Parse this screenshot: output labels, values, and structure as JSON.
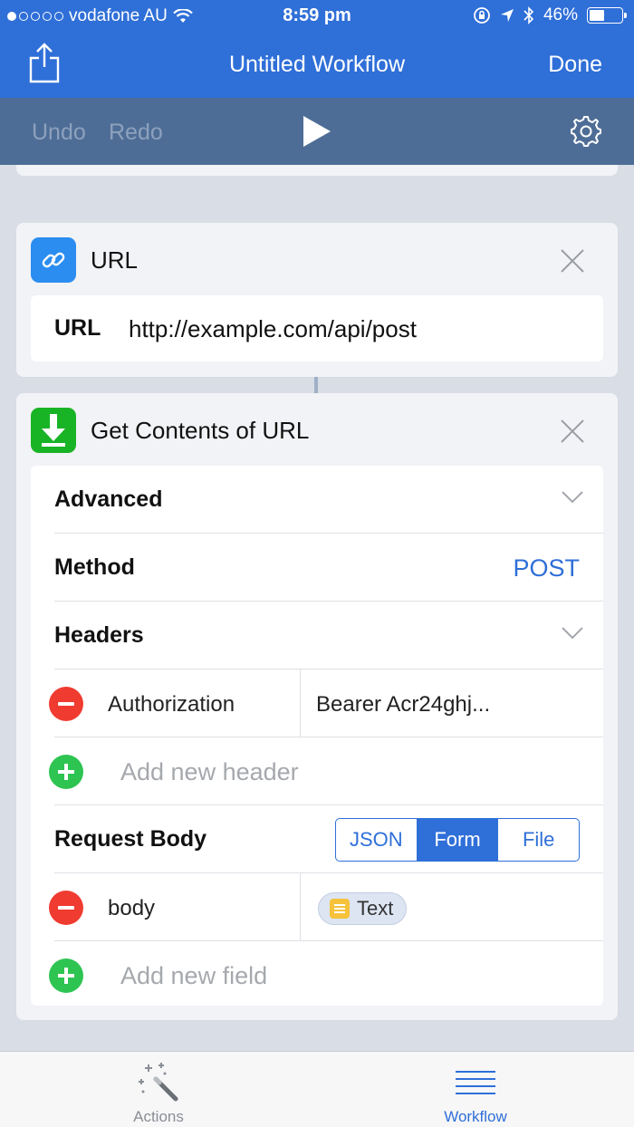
{
  "status": {
    "carrier": "vodafone AU",
    "time": "8:59 pm",
    "battery": "46%",
    "signal_bars": 1
  },
  "nav": {
    "title": "Untitled Workflow",
    "done_label": "Done"
  },
  "toolbar": {
    "undo_label": "Undo",
    "redo_label": "Redo"
  },
  "url_action": {
    "title": "URL",
    "field_label": "URL",
    "field_value": "http://example.com/api/post"
  },
  "get_action": {
    "title": "Get Contents of URL",
    "advanced_label": "Advanced",
    "method_label": "Method",
    "method_value": "POST",
    "headers_label": "Headers",
    "header_key": "Authorization",
    "header_value": "Bearer Acr24ghj...",
    "add_header_placeholder": "Add new header",
    "request_body_label": "Request Body",
    "body_types": [
      "JSON",
      "Form",
      "File"
    ],
    "selected_body_type": "Form",
    "field_key": "body",
    "field_value_token": "Text",
    "add_field_placeholder": "Add new field"
  },
  "tabs": {
    "actions_label": "Actions",
    "workflow_label": "Workflow",
    "selected": "Workflow"
  },
  "colors": {
    "accent": "#2f6fd8",
    "toolbar": "#4e6d96",
    "delete": "#f03b30",
    "add": "#2ec452"
  }
}
